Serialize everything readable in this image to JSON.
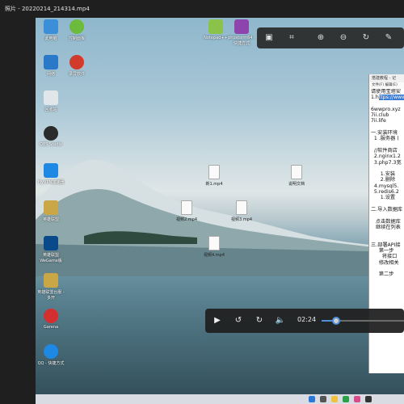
{
  "window": {
    "title": "照片 - 20220214_214314.mp4"
  },
  "desktop_icons": [
    {
      "label": "此电脑",
      "icon": "computer-icon",
      "color": "#3a8fd8"
    },
    {
      "label": "控制面板",
      "icon": "control-panel-icon",
      "color": "#6cbb3c"
    },
    {
      "label": "网络",
      "icon": "network-icon",
      "color": "#2a78c8"
    },
    {
      "label": "录屏软件",
      "icon": "record-icon",
      "color": "#d23b2b"
    },
    {
      "label": "回收站",
      "icon": "recycle-bin-icon",
      "color": "#e0e6ea"
    },
    {
      "label": "OBS Studio",
      "icon": "obs-icon",
      "color": "#2b2b2b"
    },
    {
      "label": "FlyVPN加速器",
      "icon": "vpn-icon",
      "color": "#1e88e5"
    },
    {
      "label": "英雄联盟",
      "icon": "lol-icon",
      "color": "#c9a646"
    },
    {
      "label": "英雄联盟WeGame版",
      "icon": "lol-wegame-icon",
      "color": "#0a4a8a"
    },
    {
      "label": "英雄联盟台服 - 多开",
      "icon": "lol-tw-icon",
      "color": "#c9a646"
    },
    {
      "label": "Garena",
      "icon": "garena-icon",
      "color": "#d32f2f"
    },
    {
      "label": "QQ - 快捷方式",
      "icon": "qq-icon",
      "color": "#1e88e5"
    }
  ],
  "top_icons": [
    {
      "label": "Notepad++",
      "icon": "notepad-plus-icon",
      "color": "#8bc34a"
    },
    {
      "label": "phpstorm64 - 快捷方式",
      "icon": "phpstorm-icon",
      "color": "#8e44ad"
    }
  ],
  "files": [
    {
      "label": "新1.mp4",
      "icon": "document-icon"
    },
    {
      "label": "说明文档",
      "icon": "document-icon"
    },
    {
      "label": "视频2.mp4",
      "icon": "document-icon"
    },
    {
      "label": "视频3.mp4",
      "icon": "document-icon"
    },
    {
      "label": "视频4.mp4",
      "icon": "document-icon"
    }
  ],
  "notepad": {
    "title": "搭建教程 - 记",
    "menu": "文件(F)  编辑(E)",
    "lines": [
      "请使用宝塔安",
      "1.h",
      "",
      "6wwpro.xyz",
      "7ii.club",
      "7ii.life",
      "",
      "一.安装环境",
      "  1 .服务器 (",
      "",
      "  //软件商店",
      "  2.nginx1.2",
      "  3.php7.3宽",
      "",
      "      1.安装",
      "      2.删除",
      "  4.mysql5.",
      "  5.redis6.2",
      "      1.设置",
      "",
      "二.导入数据库",
      "",
      "   点击数据库",
      "   继续在列表",
      "",
      "",
      "三.部署API接",
      "     第一步",
      "       将接口",
      "     修改相关",
      "",
      "     第二步"
    ],
    "selected": "ttps://www"
  },
  "player": {
    "timecode": "02:24",
    "progress": 0.18
  },
  "colors": {
    "accent": "#4f8fd6",
    "chrome": "#1f1f1f"
  }
}
